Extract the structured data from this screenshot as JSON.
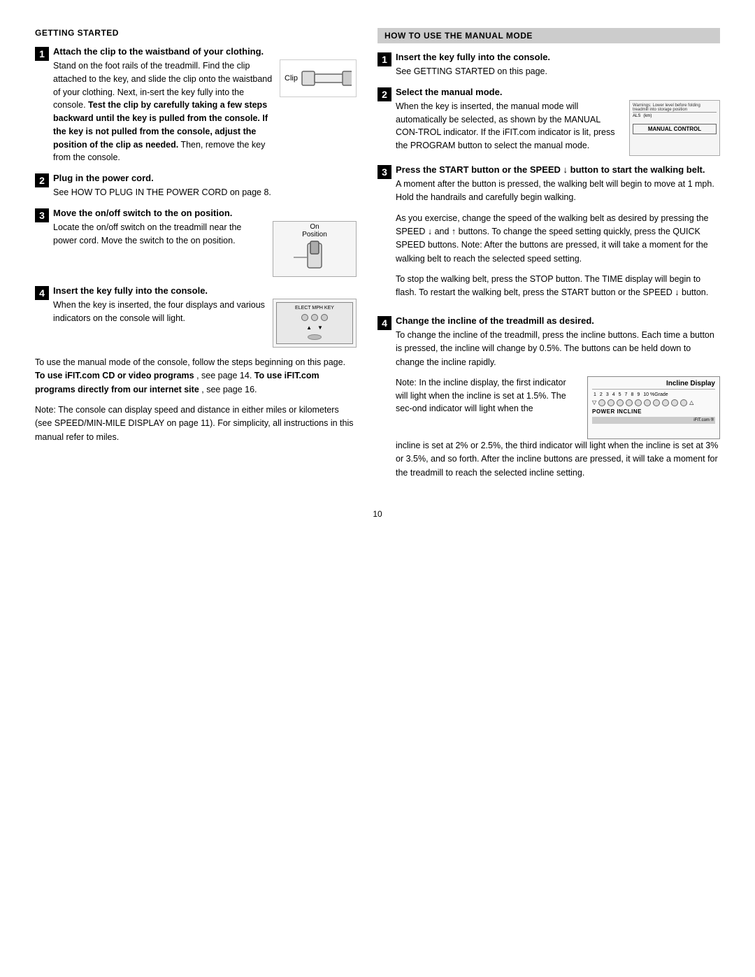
{
  "left": {
    "section_heading": "GETTING STARTED",
    "step1": {
      "number": "1",
      "title": "Attach the clip to the waistband of your clothing.",
      "text1": "Stand on the foot rails of the treadmill. Find the clip attached to the key, and slide the clip onto the waistband of your clothing. Next, in-sert the key fully into the console.",
      "text2_bold": "Test the clip by carefully taking a few steps backward until the key is pulled from the console. If the key is not pulled from the console, adjust the position of the clip as needed.",
      "text3": "Then, remove the key from the console.",
      "clip_label": "Clip"
    },
    "step2": {
      "number": "2",
      "title": "Plug in the power cord.",
      "text": "See HOW TO PLUG IN THE POWER CORD on page 8."
    },
    "step3": {
      "number": "3",
      "title": "Move the on/off switch to the on position.",
      "text": "Locate the on/off switch on the treadmill near the power cord. Move the switch to the on position.",
      "image_labels": [
        "On",
        "Position"
      ]
    },
    "step4": {
      "number": "4",
      "title": "Insert the key fully into the console.",
      "text": "When the key is inserted, the four displays and various indicators on the console will light.",
      "console_label": "ELECT MPH KEY"
    },
    "bottom_text1": "To use the manual mode of the console, follow the steps beginning on this page.",
    "bottom_text2_bold": "To use iFIT.com CD or video programs",
    "bottom_text2_rest": ", see page 14.",
    "bottom_text3_bold": "To use iFIT.com programs directly from our internet site",
    "bottom_text3_rest": ", see page 16.",
    "note": "Note: The console can display speed and distance in either miles or kilometers (see SPEED/MIN-MILE DISPLAY on page 11). For simplicity, all instructions in this manual refer to miles."
  },
  "right": {
    "section_heading": "HOW TO USE THE MANUAL MODE",
    "step1": {
      "number": "1",
      "title": "Insert the key fully into the console.",
      "text": "See GETTING STARTED on this page."
    },
    "step2": {
      "number": "2",
      "title": "Select the manual mode.",
      "text": "When the key is inserted, the manual mode will automatically be selected, as shown by the MANUAL CON-TROL indicator. If the iFIT.com indicator is lit, press the PROGRAM button to select the manual mode.",
      "manual_control_label": "MANUAL CONTROL"
    },
    "step3": {
      "number": "3",
      "title": "Press the START button or the SPEED ↓ button to start the walking belt.",
      "para1": "A moment after the button is pressed, the walking belt will begin to move at 1 mph. Hold the handrails and carefully begin walking.",
      "para2": "As you exercise, change the speed of the walking belt as desired by pressing the SPEED ↓ and ↑ buttons. To change the speed setting quickly, press the QUICK SPEED buttons. Note: After the buttons are pressed, it will take a moment for the walking belt to reach the selected speed setting.",
      "para3": "To stop the walking belt, press the STOP button. The TIME display will begin to flash. To restart the walking belt, press the START button or the SPEED ↓ button."
    },
    "step4": {
      "number": "4",
      "title": "Change the incline of the treadmill as desired.",
      "para1": "To change the incline of the treadmill, press the incline buttons. Each time a button is pressed, the incline will change by 0.5%. The buttons can be held down to change the incline rapidly.",
      "note_text": "Note: In the incline display, the first indicator will light when the incline is set at 1.5%. The second indicator will light when the",
      "incline_display_title": "Incline Display",
      "power_incline_label": "POWER INCLINE",
      "para2": "incline is set at 2% or 2.5%, the third indicator will light when the incline is set at 3% or 3.5%, and so forth. After the incline buttons are pressed, it will take a moment for the treadmill to reach the selected incline setting."
    }
  },
  "page_number": "10"
}
